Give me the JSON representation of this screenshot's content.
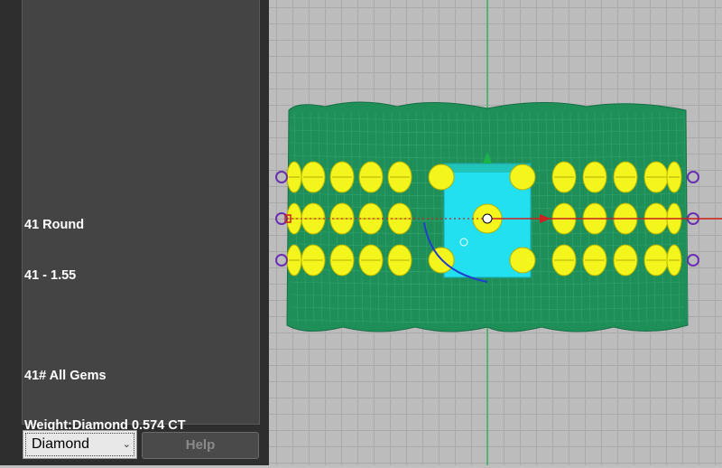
{
  "panel": {
    "info_lines": [
      "41 Round",
      "41 - 1.55",
      "",
      "41# All Gems",
      "Weight:Diamond 0.574 CT"
    ]
  },
  "controls": {
    "material_select": {
      "value": "Diamond",
      "chevron": "⌄"
    },
    "help_label": "Help"
  },
  "viewport": {
    "colors": {
      "ring_body": "#1f8f5a",
      "gem": "#f5f51e",
      "center_stone": "#22e0f0",
      "axis_x": "#cc1f1f",
      "axis_y": "#19b34a",
      "axis_z": "#1f3fcc",
      "prong": "#6a2fb0",
      "grid": "#a9a9a9"
    },
    "icons": [
      "gumball-widget",
      "rotation-arc",
      "move-arrow"
    ]
  }
}
